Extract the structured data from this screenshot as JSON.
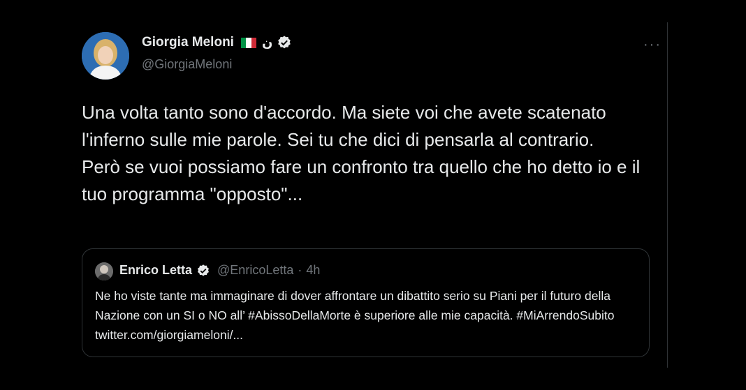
{
  "tweet": {
    "author": {
      "display_name": "Giorgia Meloni",
      "extra_glyph": "ن",
      "handle": "@GiorgiaMeloni",
      "flag_colors": [
        "#009246",
        "#ffffff",
        "#ce2b37"
      ]
    },
    "more_label": "···",
    "text_lines": [
      "Una volta tanto sono d'accordo. Ma siete voi che avete scatenato l'inferno sulle mie parole. Sei tu che dici di pensarla al contrario.",
      "Però se vuoi possiamo fare un confronto tra quello che ho detto io e il tuo programma \"opposto\"..."
    ]
  },
  "quote": {
    "display_name": "Enrico Letta",
    "handle": "@EnricoLetta",
    "separator": "·",
    "time": "4h",
    "text": "Ne ho viste tante ma immaginare di dover affrontare un dibattito serio su Piani per il futuro della Nazione con un SI o NO all’ #AbissoDellaMorte è superiore alle mie capacità. #MiArrendoSubito twitter.com/giorgiameloni/..."
  },
  "colors": {
    "background": "#000000",
    "text_primary": "#e7e9ea",
    "text_secondary": "#71767b",
    "border": "#2f3336",
    "verified_badge": "#e7e9ea"
  },
  "icons": {
    "verified": "verified-badge-icon",
    "more": "more-options-icon"
  }
}
